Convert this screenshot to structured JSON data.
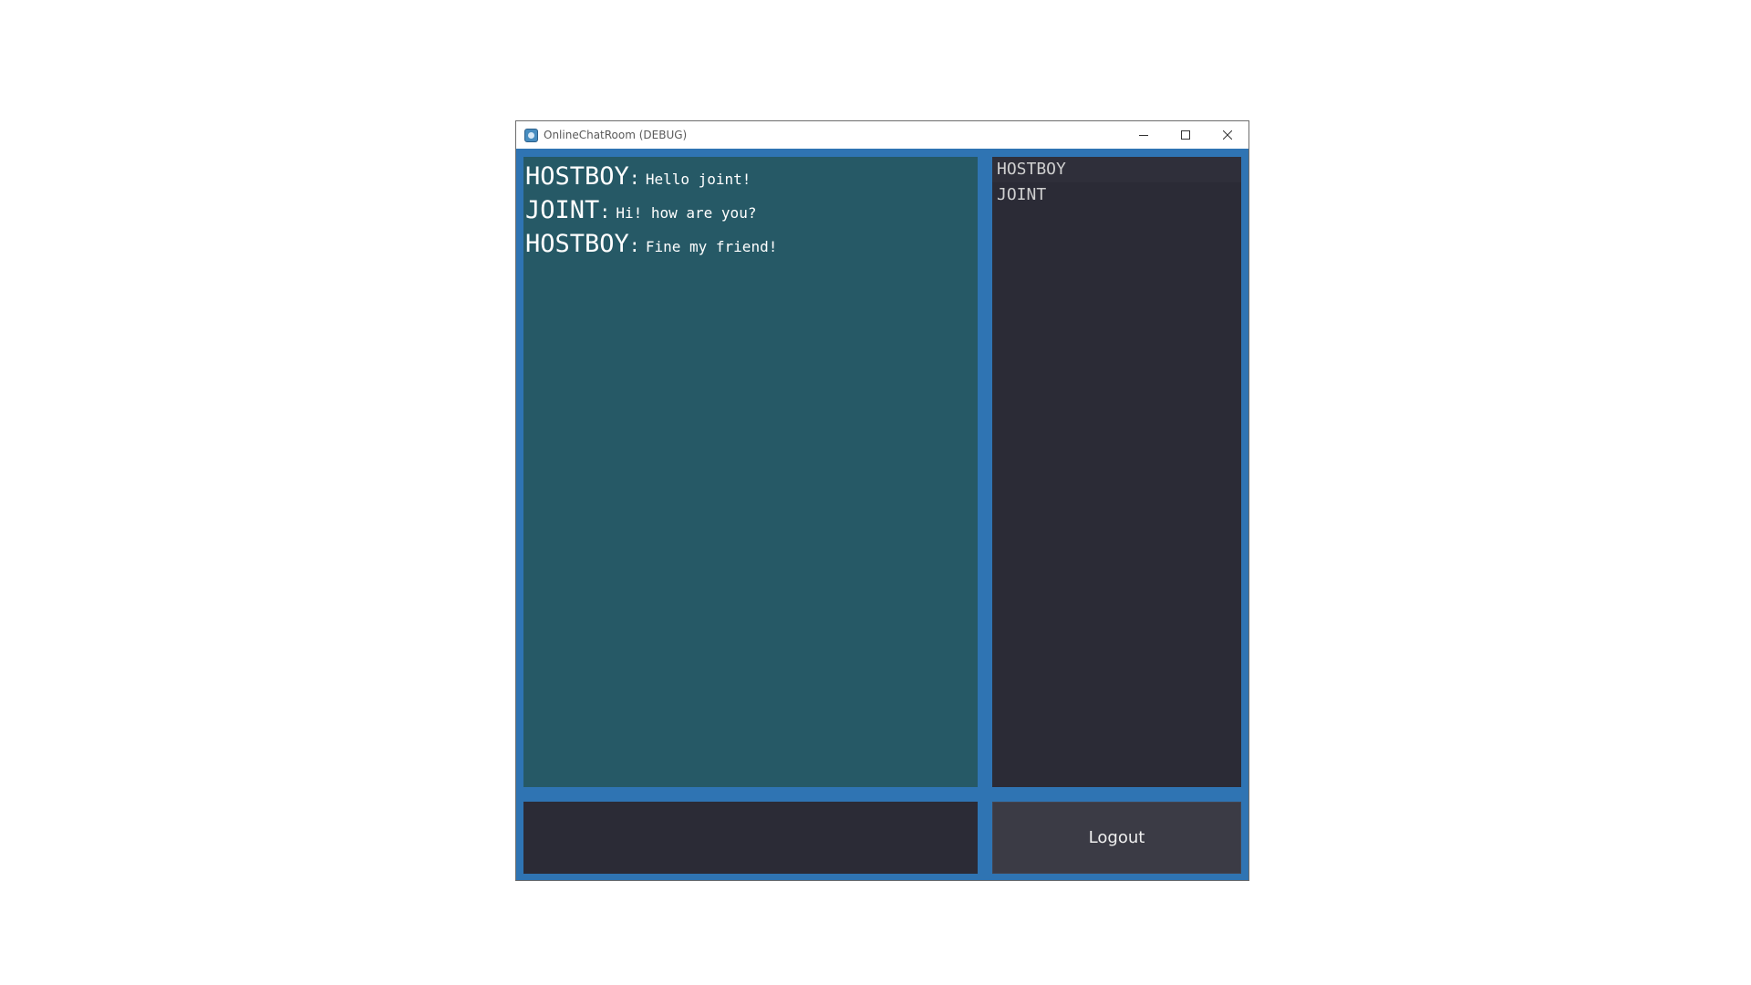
{
  "window": {
    "title": "OnlineChatRoom (DEBUG)",
    "icon": "godot-app-icon",
    "controls": [
      "minimize-icon",
      "maximize-icon",
      "close-icon"
    ]
  },
  "chat": {
    "messages": [
      {
        "user": "HOSTBOY",
        "separator": ":",
        "text": "Hello joint!"
      },
      {
        "user": "JOINT",
        "separator": ":",
        "text": "Hi! how are you?"
      },
      {
        "user": "HOSTBOY",
        "separator": ":",
        "text": "Fine my friend!"
      }
    ]
  },
  "users": {
    "items": [
      "HOSTBOY",
      "JOINT"
    ]
  },
  "input": {
    "value": "",
    "placeholder": ""
  },
  "logout": {
    "label": "Logout"
  },
  "colors": {
    "frame": "#2f74b3",
    "chat_bg": "#265966",
    "panel_bg": "#2b2b36",
    "button_bg": "#3b3b45"
  }
}
